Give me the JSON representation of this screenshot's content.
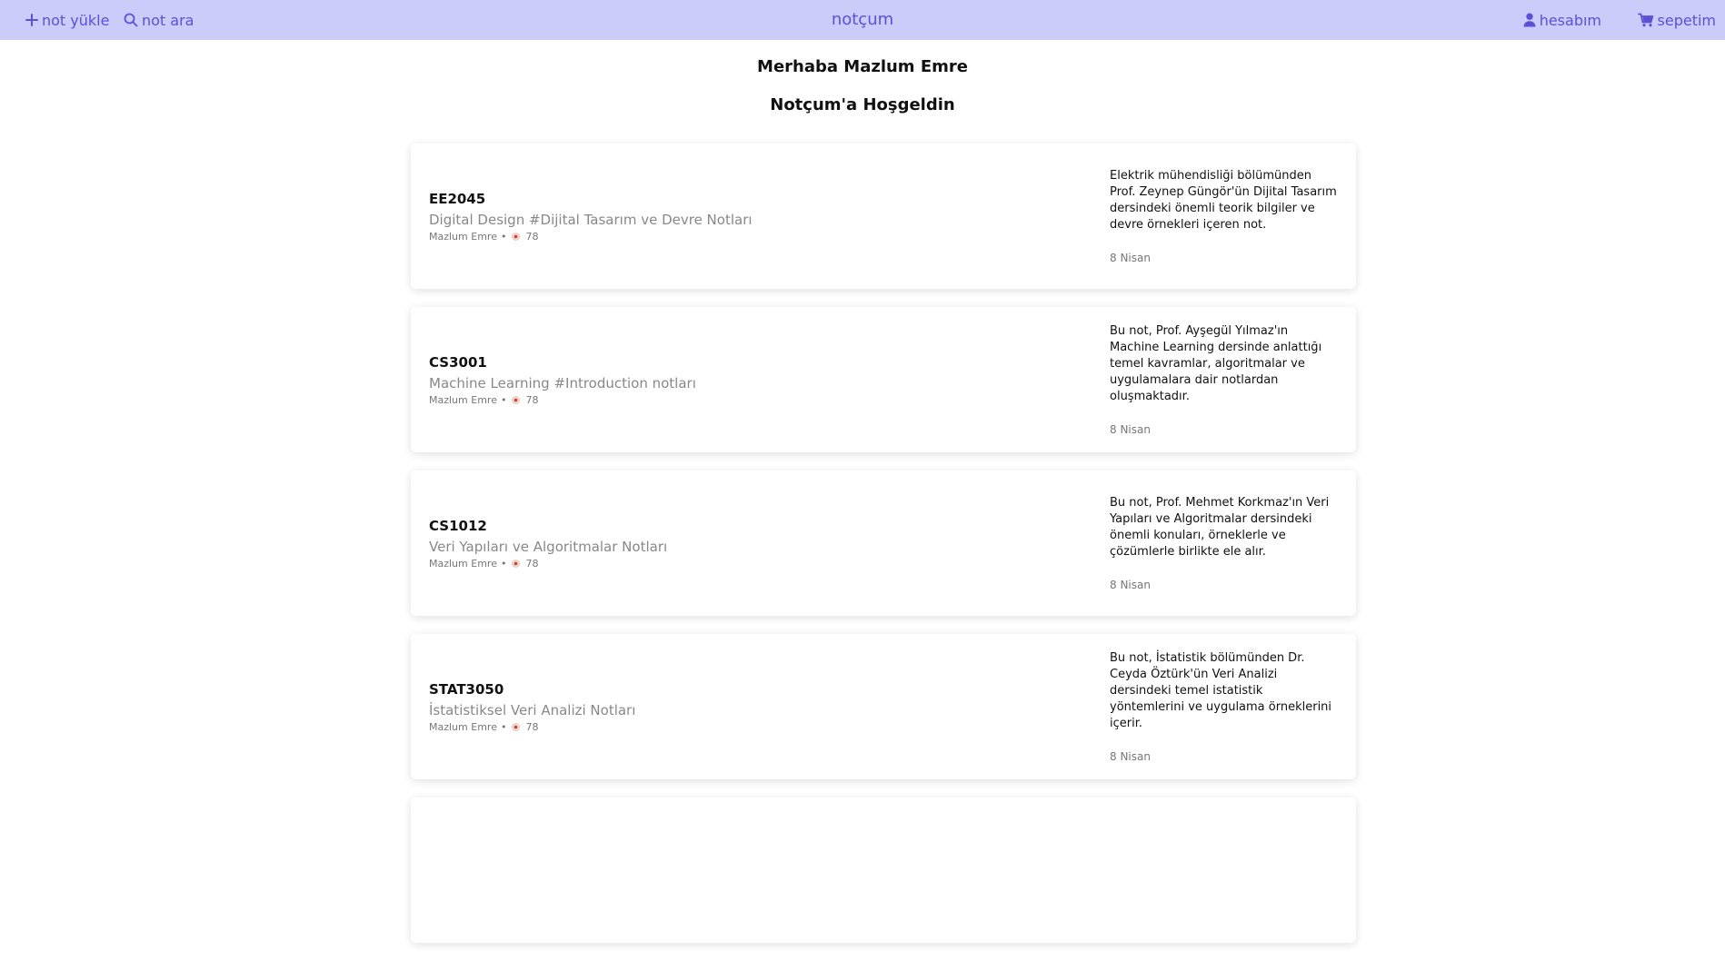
{
  "nav": {
    "upload_label": "not yükle",
    "search_label": "not ara",
    "brand": "notçum",
    "account_label": "hesabım",
    "cart_label": "sepetim",
    "color": "#5b50d6",
    "background": "#ccccfb"
  },
  "greeting": {
    "line1": "Merhaba Mazlum Emre",
    "line2": "Notçum'a Hoşgeldin"
  },
  "notes": [
    {
      "code": "EE2045",
      "title": "Digital Design #Dijital Tasarım ve Devre Notları",
      "author": "Mazlum Emre",
      "separator": "•",
      "views": "78",
      "description": "Elektrik mühendisliği bölümünden Prof. Zeynep Güngör'ün Dijital Tasarım dersindeki önemli teorik bilgiler ve devre örnekleri içeren not.",
      "date": "8 Nisan"
    },
    {
      "code": "CS3001",
      "title": "Machine Learning #Introduction notları",
      "author": "Mazlum Emre",
      "separator": "•",
      "views": "78",
      "description": "Bu not, Prof. Ayşegül Yılmaz'ın Machine Learning dersinde anlattığı temel kavramlar, algoritmalar ve uygulamalara dair notlardan oluşmaktadır.",
      "date": "8 Nisan"
    },
    {
      "code": "CS1012",
      "title": "Veri Yapıları ve Algoritmalar Notları",
      "author": "Mazlum Emre",
      "separator": "•",
      "views": "78",
      "description": "Bu not, Prof. Mehmet Korkmaz'ın Veri Yapıları ve Algoritmalar dersindeki önemli konuları, örneklerle ve çözümlerle birlikte ele alır.",
      "date": "8 Nisan"
    },
    {
      "code": "STAT3050",
      "title": "İstatistiksel Veri Analizi Notları",
      "author": "Mazlum Emre",
      "separator": "•",
      "views": "78",
      "description": "Bu not, İstatistik bölümünden Dr. Ceyda Öztürk'ün Veri Analizi dersindeki temel istatistik yöntemlerini ve uygulama örneklerini içerir.",
      "date": "8 Nisan"
    }
  ]
}
